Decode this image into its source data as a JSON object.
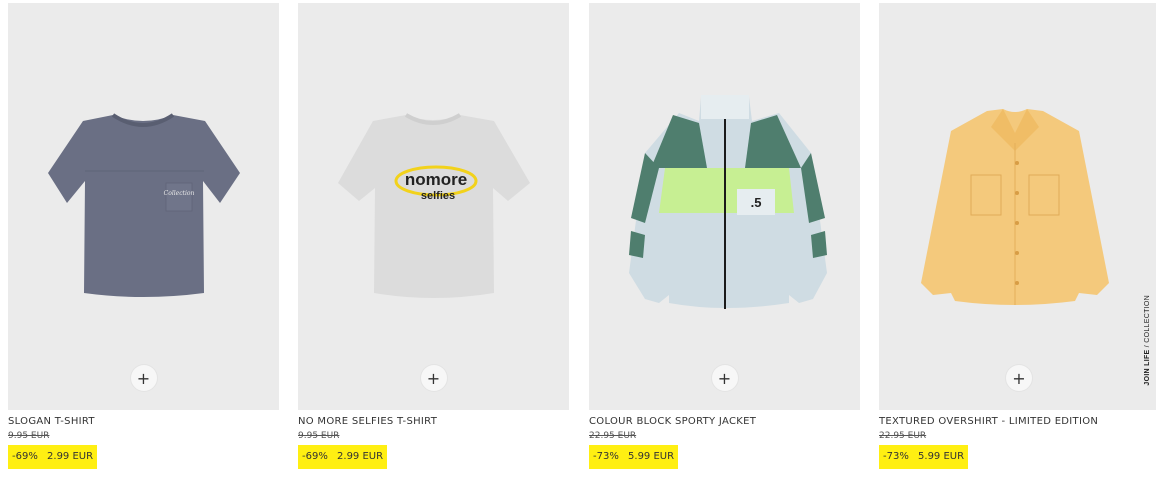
{
  "products": [
    {
      "name": "SLOGAN T-SHIRT",
      "old_price": "9.95 EUR",
      "discount": "-69%",
      "price": "2.99 EUR",
      "add_label": "+"
    },
    {
      "name": "NO MORE SELFIES T-SHIRT",
      "old_price": "9.95 EUR",
      "discount": "-69%",
      "price": "2.99 EUR",
      "add_label": "+",
      "print_text_1": "nomore",
      "print_text_2": "selfies"
    },
    {
      "name": "COLOUR BLOCK SPORTY JACKET",
      "old_price": "22.95 EUR",
      "discount": "-73%",
      "price": "5.99 EUR",
      "add_label": "+"
    },
    {
      "name": "TEXTURED OVERSHIRT - LIMITED EDITION",
      "old_price": "22.95 EUR",
      "discount": "-73%",
      "price": "5.99 EUR",
      "add_label": "+",
      "badge_bold": "JOIN LIFE",
      "badge_rest": " / COLLECTION"
    }
  ],
  "colors": {
    "sale_highlight": "#ffef12",
    "image_bg": "#ebebeb"
  }
}
